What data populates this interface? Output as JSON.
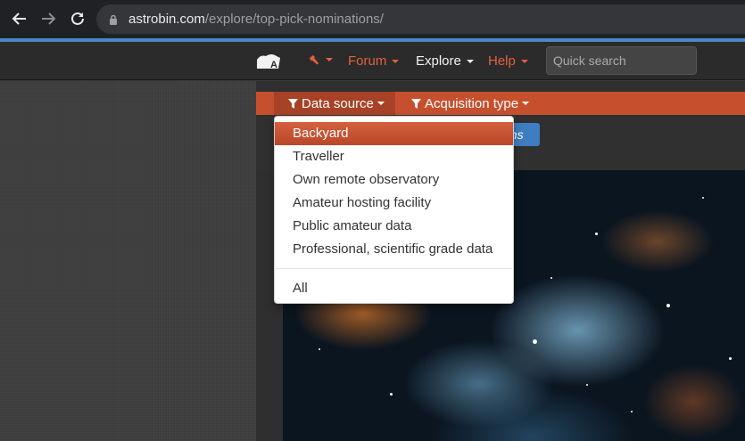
{
  "browser": {
    "url_domain": "astrobin.com",
    "url_path": "/explore/top-pick-nominations/"
  },
  "header": {
    "menu": [
      {
        "label": "Forum",
        "color": "#e2603e"
      },
      {
        "label": "Explore",
        "color": "#f2f2f2"
      },
      {
        "label": "Help",
        "color": "#e2603e"
      }
    ],
    "search_placeholder": "Quick search"
  },
  "filters": {
    "data_source_label": "Data source",
    "acquisition_type_label": "Acquisition type",
    "nominations_partial": "ons"
  },
  "dropdown": {
    "items": [
      {
        "label": "Backyard",
        "selected": true
      },
      {
        "label": "Traveller"
      },
      {
        "label": "Own remote observatory"
      },
      {
        "label": "Amateur hosting facility"
      },
      {
        "label": "Public amateur data"
      },
      {
        "label": "Professional, scientific grade data"
      }
    ],
    "all_label": "All"
  },
  "colors": {
    "accent": "#c6502e",
    "selected": "#c9573a",
    "link_blue": "#3e7dc0"
  }
}
